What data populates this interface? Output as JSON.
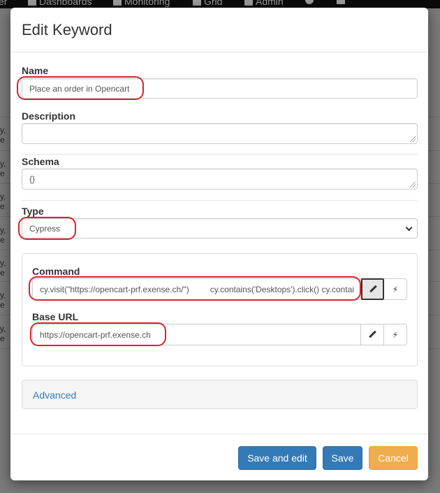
{
  "navbar": {
    "items": [
      {
        "label": "er",
        "icon": ""
      },
      {
        "label": "Dashboards",
        "icon": "bar-chart-icon"
      },
      {
        "label": "Monitoring",
        "icon": "dashboard-icon"
      },
      {
        "label": "Grid",
        "icon": "grid-icon"
      },
      {
        "label": "Admin",
        "icon": "gear-icon"
      },
      {
        "label": "",
        "icon": "help-icon"
      },
      {
        "label": "",
        "icon": "menu-icon"
      }
    ]
  },
  "background": {
    "row_stub": "y, e"
  },
  "modal": {
    "title": "Edit Keyword",
    "name": {
      "label": "Name",
      "value": "Place an order in Opencart"
    },
    "description": {
      "label": "Description",
      "value": ""
    },
    "schema": {
      "label": "Schema",
      "value": "{}"
    },
    "type": {
      "label": "Type",
      "value": "Cypress"
    },
    "command": {
      "label": "Command",
      "value": "cy.visit(\"https://opencart-prf.exense.ch/\")         cy.contains('Desktops').click() cy.contai"
    },
    "base_url": {
      "label": "Base URL",
      "value": "https://opencart-prf.exense.ch"
    },
    "advanced": {
      "label": "Advanced"
    },
    "buttons": {
      "save_and_edit": "Save and edit",
      "save": "Save",
      "cancel": "Cancel"
    }
  },
  "colors": {
    "primary": "#337ab7",
    "warning": "#f0ad4e",
    "highlight": "#d9232e",
    "link": "#337ab7"
  }
}
